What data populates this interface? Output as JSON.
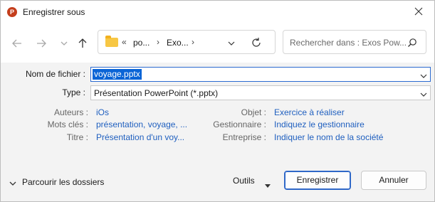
{
  "window": {
    "title": "Enregistrer sous"
  },
  "address": {
    "chevrons": "«",
    "crumbs": [
      "po...",
      "Exo..."
    ],
    "separator": "›",
    "trailing_separator": "›"
  },
  "search": {
    "placeholder": "Rechercher dans : Exos Pow..."
  },
  "form": {
    "filename_label": "Nom de fichier :",
    "filename_value": "voyage.pptx",
    "type_label": "Type :",
    "type_value": "Présentation PowerPoint (*.pptx)"
  },
  "properties": {
    "left": [
      {
        "label": "Auteurs :",
        "value": "iOs"
      },
      {
        "label": "Mots clés :",
        "value": "présentation, voyage, ..."
      },
      {
        "label": "Titre :",
        "value": "Présentation d'un voy..."
      }
    ],
    "right": [
      {
        "label": "Objet :",
        "value": "Exercice à réaliser"
      },
      {
        "label": "Gestionnaire :",
        "value": "Indiquez le gestionnaire"
      },
      {
        "label": "Entreprise :",
        "value": "Indiquer le nom de la société"
      }
    ]
  },
  "footer": {
    "browse_label": "Parcourir les dossiers",
    "tools_label": "Outils",
    "save_label": "Enregistrer",
    "cancel_label": "Annuler"
  },
  "colors": {
    "accent": "#0a64d6",
    "link": "#1f5fbf",
    "app_icon": "#c43e1c"
  }
}
